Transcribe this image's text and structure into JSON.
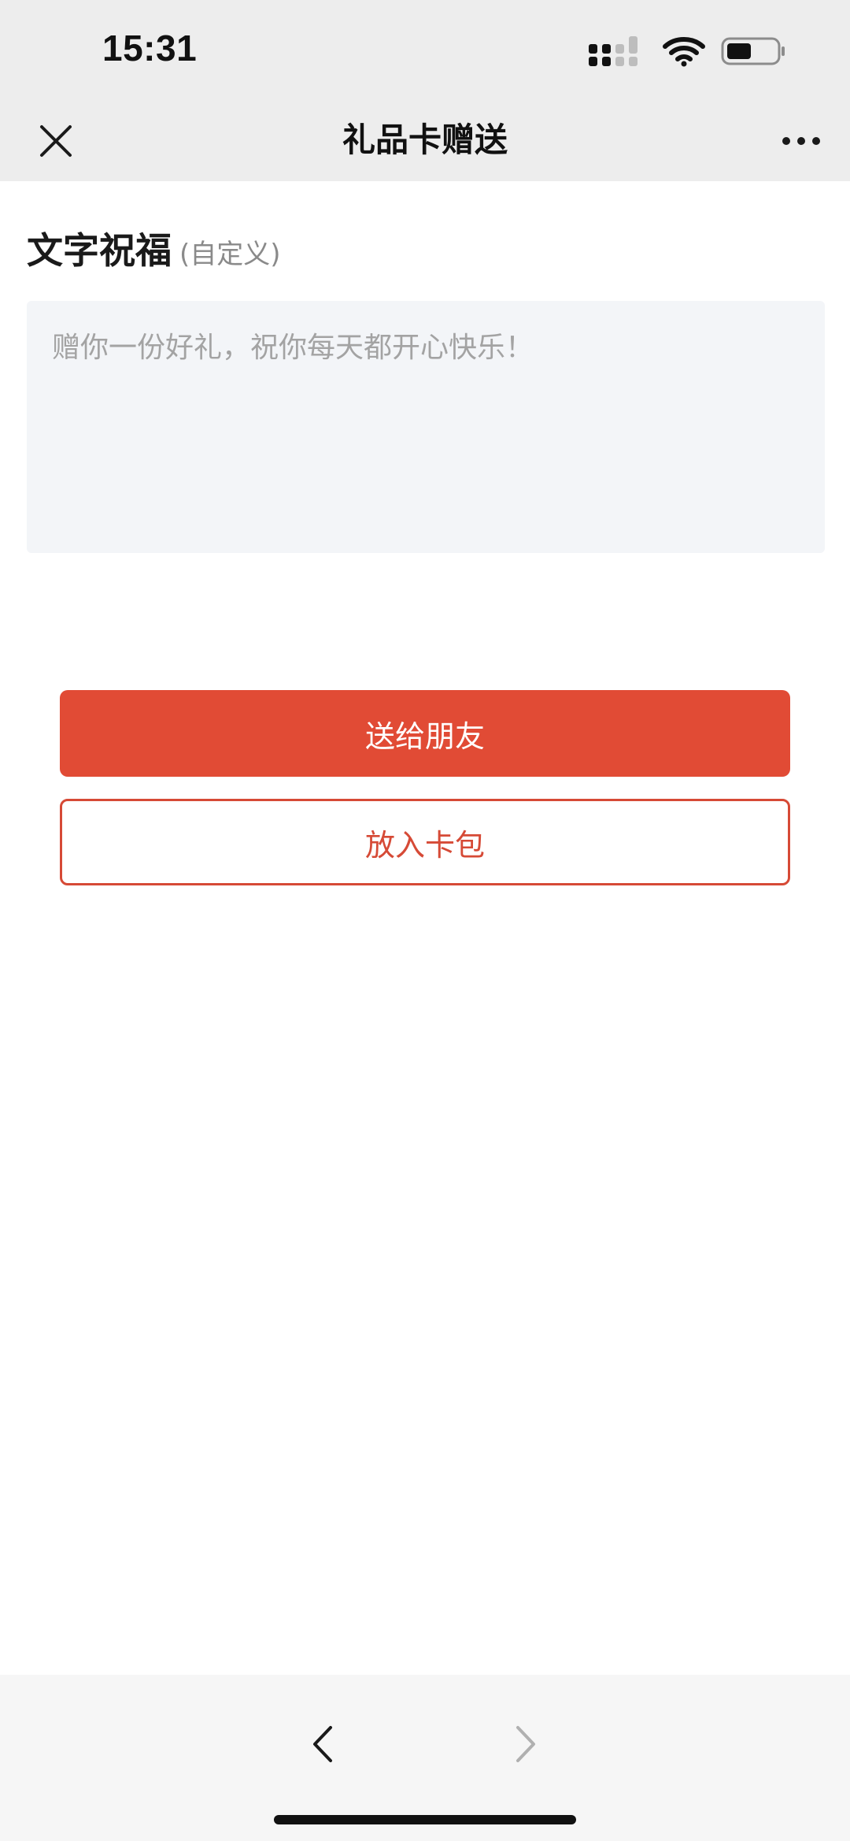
{
  "status_bar": {
    "time": "15:31"
  },
  "nav": {
    "title": "礼品卡赠送"
  },
  "blessing": {
    "title": "文字祝福",
    "subtitle": "(自定义)",
    "placeholder": "赠你一份好礼，祝你每天都开心快乐！",
    "value": ""
  },
  "actions": {
    "send_label": "送给朋友",
    "wallet_label": "放入卡包"
  },
  "colors": {
    "accent": "#e14b35",
    "nav_background": "#ededed",
    "input_background": "#f3f5f8"
  },
  "icons": {
    "close": "close-icon",
    "more": "more-icon",
    "back": "chevron-left-icon",
    "forward": "chevron-right-icon",
    "signal": "signal-icon",
    "wifi": "wifi-icon",
    "battery": "battery-icon"
  }
}
